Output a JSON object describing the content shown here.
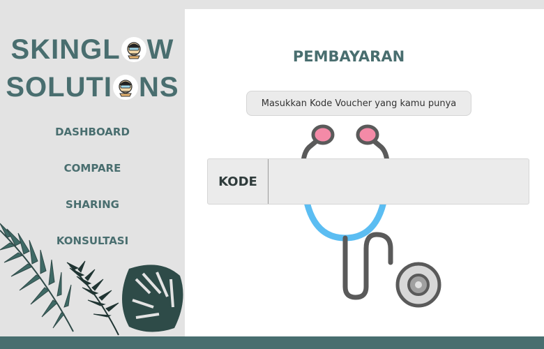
{
  "logo": {
    "line1_a": "SKINGL",
    "line1_b": "W",
    "line2_a": "SOLUTI",
    "line2_b": "NS"
  },
  "nav": {
    "items": [
      "DASHBOARD",
      "COMPARE",
      "SHARING",
      "KONSULTASI"
    ]
  },
  "main": {
    "title": "PEMBAYARAN",
    "voucher_button": "Masukkan Kode Voucher yang kamu punya",
    "code_label": "KODE",
    "code_value": "",
    "code_placeholder": ""
  },
  "colors": {
    "brand": "#496e6f",
    "footer": "#486e6f",
    "stethoscope_tube": "#5a5a5a",
    "stethoscope_blue": "#5bbdf2",
    "stethoscope_pink": "#f48aa7"
  },
  "icons": [
    "avatar-face-icon",
    "stethoscope-illustration",
    "tropical-leaves-decoration"
  ]
}
